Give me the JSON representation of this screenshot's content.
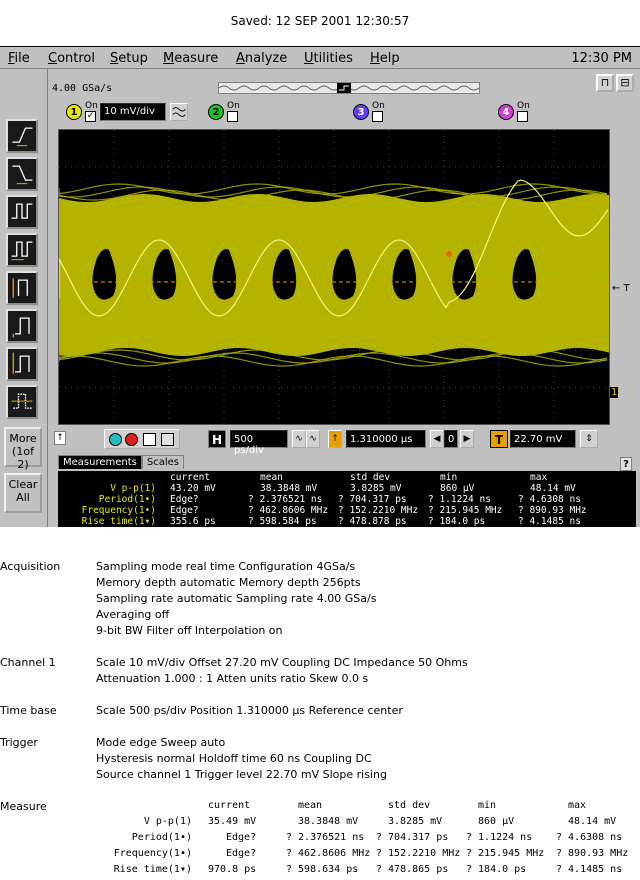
{
  "header": {
    "saved": "Saved:  12 SEP 2001  12:30:57"
  },
  "menu": {
    "items": [
      {
        "label": "File",
        "ul": "F",
        "rest": "ile"
      },
      {
        "label": "Control",
        "ul": "C",
        "rest": "ontrol"
      },
      {
        "label": "Setup",
        "ul": "S",
        "rest": "etup"
      },
      {
        "label": "Measure",
        "ul": "M",
        "rest": "easure"
      },
      {
        "label": "Analyze",
        "ul": "A",
        "rest": "nalyze"
      },
      {
        "label": "Utilities",
        "ul": "U",
        "rest": "tilities"
      },
      {
        "label": "Help",
        "ul": "H",
        "rest": "elp"
      }
    ],
    "clock": "12:30 PM"
  },
  "scope": {
    "sample_rate": "4.00 GSa/s",
    "channels": [
      {
        "num": "1",
        "on_label": "On",
        "checked": "✓",
        "scale": "10 mV/div",
        "color": "#e8e800"
      },
      {
        "num": "2",
        "on_label": "On",
        "checked": "",
        "color": "#20c020"
      },
      {
        "num": "3",
        "on_label": "On",
        "checked": "",
        "color": "#6040ff"
      },
      {
        "num": "4",
        "on_label": "On",
        "checked": "",
        "color": "#d040d0"
      }
    ],
    "trigger_marker": "← T",
    "ground_marker": "1",
    "timebase": "500 ps/div",
    "position": "1.310000 µs",
    "delay_value": "0",
    "trigger_level": "22.70 mV",
    "waveform_color": "#b4b400",
    "more_label": "More",
    "more_sub": "(1of 2)",
    "clear_label": "Clear",
    "clear_sub": "All"
  },
  "tabs": {
    "measurements": "Measurements",
    "scales": "Scales"
  },
  "measurement_panel": {
    "headers": [
      "current",
      "mean",
      "std dev",
      "min",
      "max"
    ],
    "rows": [
      {
        "name": "V p-p(1)",
        "current": "43.20 mV",
        "mean": "38.3848 mV",
        "std": "3.8285 mV",
        "min": "860 µV",
        "max": "48.14 mV"
      },
      {
        "name": "Period(1•)",
        "current": "Edge?",
        "mean": "? 2.376521 ns",
        "std": "? 704.317 ps",
        "min": "? 1.1224 ns",
        "max": "? 4.6308 ns"
      },
      {
        "name": "Frequency(1•)",
        "current": "Edge?",
        "mean": "? 462.8606 MHz",
        "std": "? 152.2210 MHz",
        "min": "? 215.945 MHz",
        "max": "? 890.93 MHz"
      },
      {
        "name": "Rise time(1▾)",
        "current": "355.6 ps",
        "mean": "? 598.584 ps",
        "std": "? 478.878 ps",
        "min": "? 184.0 ps",
        "max": "? 4.1485 ns"
      }
    ]
  },
  "report": {
    "acquisition": {
      "label": "Acquisition",
      "lines": [
        "Sampling mode real time Configuration 4GSa/s",
        "Memory depth automatic Memory depth 256pts",
        "Sampling rate automatic Sampling rate 4.00 GSa/s",
        "Averaging off",
        "9-bit BW Filter off Interpolation on"
      ]
    },
    "channel1": {
      "label": "Channel 1",
      "lines": [
        "Scale 10 mV/div Offset 27.20 mV Coupling DC Impedance 50 Ohms",
        "Attenuation 1.000  : 1 Atten units ratio Skew 0.0 s"
      ]
    },
    "timebase": {
      "label": "Time base",
      "lines": [
        "Scale 500 ps/div Position 1.310000 µs Reference center"
      ]
    },
    "trigger": {
      "label": "Trigger",
      "lines": [
        "Mode edge Sweep auto",
        "Hysteresis normal Holdoff time 60 ns Coupling DC",
        "Source channel 1 Trigger level 22.70 mV Slope rising"
      ]
    },
    "measure": {
      "label": "Measure",
      "headers": [
        "current",
        "mean",
        "std dev",
        "min",
        "max"
      ],
      "rows": [
        {
          "name": "V p-p(1)",
          "current": "35.49 mV",
          "mean": "38.3848 mV",
          "std": "3.8285 mV",
          "min": "860 µV",
          "max": "48.14 mV"
        },
        {
          "name": "Period(1•)",
          "current": "Edge?",
          "mean": "? 2.376521 ns",
          "std": "? 704.317 ps",
          "min": "? 1.1224 ns",
          "max": "? 4.6308 ns"
        },
        {
          "name": "Frequency(1•)",
          "current": "Edge?",
          "mean": "? 462.8606 MHz",
          "std": "? 152.2210 MHz",
          "min": "? 215.945 MHz",
          "max": "? 890.93 MHz"
        },
        {
          "name": "Rise time(1▾)",
          "current": "970.8 ps",
          "mean": "? 598.634 ps",
          "std": "? 478.865 ps",
          "min": "? 184.0 ps",
          "max": "? 4.1485 ns"
        }
      ]
    }
  }
}
